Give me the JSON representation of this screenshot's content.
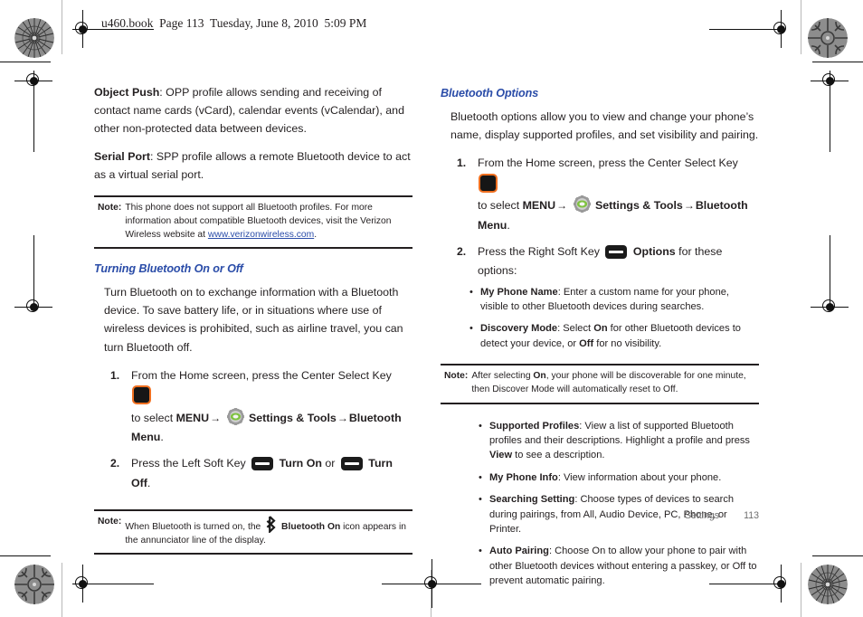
{
  "header": {
    "text": "u460.book  Page 113  Tuesday, June 8, 2010  5:09 PM"
  },
  "colors": {
    "heading_blue": "#2a4ca8",
    "link_blue": "#2a4ca8",
    "body_black": "#231f20",
    "accent_orange": "#ef6f20",
    "gear_green": "#7fc241",
    "footer_gray": "#6f6f6f"
  },
  "left_column": {
    "paragraphs": [
      {
        "lead": "Object Push",
        "rest": ": OPP profile allows sending and receiving of contact name cards (vCard), calendar events (vCalendar), and other non-protected data between devices."
      },
      {
        "lead": "Serial Port",
        "rest": ": SPP profile allows a remote Bluetooth device to act as a virtual serial port."
      }
    ],
    "note_profiles": {
      "label": "Note:",
      "text_before_link": "This phone does not support all Bluetooth profiles. For more information about compatible Bluetooth devices, visit the Verizon Wireless website at ",
      "link_text": "www.verizonwireless.com",
      "text_after_link": "."
    },
    "section_heading": "Turning Bluetooth On or Off",
    "section_intro": "Turn Bluetooth on to exchange information with a Bluetooth device. To save battery life, or in situations where use of wireless devices is prohibited, such as airline travel, you can turn Bluetooth off.",
    "steps": [
      {
        "number": "1.",
        "part1": "From the Home screen, press the Center Select Key",
        "icon1": "center-select-key-icon",
        "part2": "to select ",
        "menu_label": "MENU",
        "arrow": "→",
        "icon2": "gear-settings-icon",
        "settings_label": "Settings & Tools",
        "bluetooth_menu_label": "Bluetooth Menu",
        "period": "."
      },
      {
        "number": "2.",
        "part1": "Press the Left Soft Key",
        "icon1": "left-soft-key-icon",
        "turn_on_label": "Turn On",
        "or_label": "or",
        "icon2": "left-soft-key-icon",
        "turn_off_label": "Turn Off",
        "period": "."
      }
    ],
    "note_bluetooth_on": {
      "label": "Note:",
      "text_before_icon": "When Bluetooth is turned on, the",
      "icon": "bluetooth-icon",
      "bold_label": "Bluetooth On",
      "text_after_icon": "icon appears in the annunciator line of the display."
    }
  },
  "right_column": {
    "section_heading": "Bluetooth Options",
    "section_intro": "Bluetooth options allow you to view and change your phone’s name, display supported profiles, and set visibility and pairing.",
    "steps": [
      {
        "number": "1.",
        "part1": "From the Home screen, press the Center Select Key",
        "icon1": "center-select-key-icon",
        "part2": "to select ",
        "menu_label": "MENU",
        "arrow": "→",
        "icon2": "gear-settings-icon",
        "settings_label": "Settings & Tools",
        "bluetooth_menu_label": "Bluetooth Menu",
        "period": "."
      },
      {
        "number": "2.",
        "part1": "Press the Right Soft Key",
        "icon1": "right-soft-key-icon",
        "options_label": "Options",
        "part2": "for these options:"
      }
    ],
    "options_group_1": [
      {
        "lead": "My Phone Name",
        "rest": ": Enter a custom name for your phone, visible to other Bluetooth devices during searches."
      },
      {
        "lead": "Discovery Mode",
        "rest_a": ": Select ",
        "bold_a": "On",
        "rest_b": " for other Bluetooth devices to detect your device, or ",
        "bold_b": "Off",
        "rest_c": " for no visibility."
      }
    ],
    "note_discovery": {
      "label": "Note:",
      "text_a": "After selecting ",
      "bold_a": "On",
      "text_b": ", your phone will be discoverable for one minute, then Discover Mode will automatically reset to Off."
    },
    "options_group_2": [
      {
        "lead": "Supported Profiles",
        "rest_a": ": View a list of supported Bluetooth profiles and their descriptions. Highlight a profile and press ",
        "bold_a": "View",
        "rest_b": " to see a description."
      },
      {
        "lead": "My Phone Info",
        "rest": ": View information about your phone."
      },
      {
        "lead": "Searching Setting",
        "rest": ": Choose types of devices to search during pairings, from All, Audio Device, PC, Phone, or Printer."
      },
      {
        "lead": "Auto Pairing",
        "rest": ": Choose On to allow your phone to pair with other Bluetooth devices without entering a passkey, or Off to prevent automatic pairing."
      }
    ]
  },
  "footer": {
    "section": "Settings",
    "page_number": "113"
  }
}
